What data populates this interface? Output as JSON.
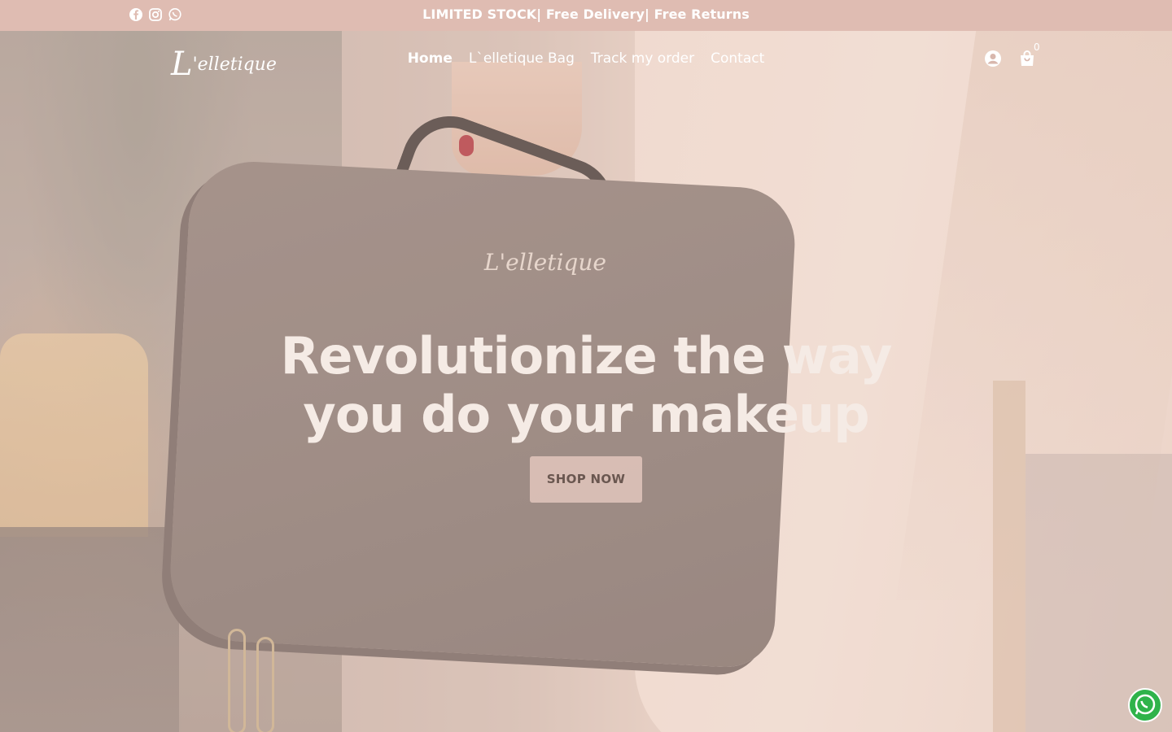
{
  "announcement": {
    "text": "LIMITED STOCK| Free Delivery| Free Returns",
    "socials": [
      {
        "icon": "facebook-icon"
      },
      {
        "icon": "instagram-icon"
      },
      {
        "icon": "whatsapp-icon"
      }
    ]
  },
  "header": {
    "logo_prefix": "L",
    "logo_text": "'elletique",
    "nav": [
      {
        "label": "Home",
        "active": true
      },
      {
        "label": "L`elletique Bag",
        "active": false
      },
      {
        "label": "Track my order",
        "active": false
      },
      {
        "label": "Contact",
        "active": false
      }
    ],
    "account_icon": "account-icon",
    "cart_icon": "cart-icon",
    "cart_count": "0"
  },
  "hero": {
    "headline_line1": "Revolutionize the way",
    "headline_line2": "you do your makeup",
    "button_label": "SHOP NOW",
    "bag_logo": "L'elletique"
  },
  "floating": {
    "whatsapp_icon": "whatsapp-float-icon"
  },
  "colors": {
    "announcement_bg": "#dfbcb2",
    "button_bg": "#e2c6bc",
    "button_text": "#6a5750"
  }
}
